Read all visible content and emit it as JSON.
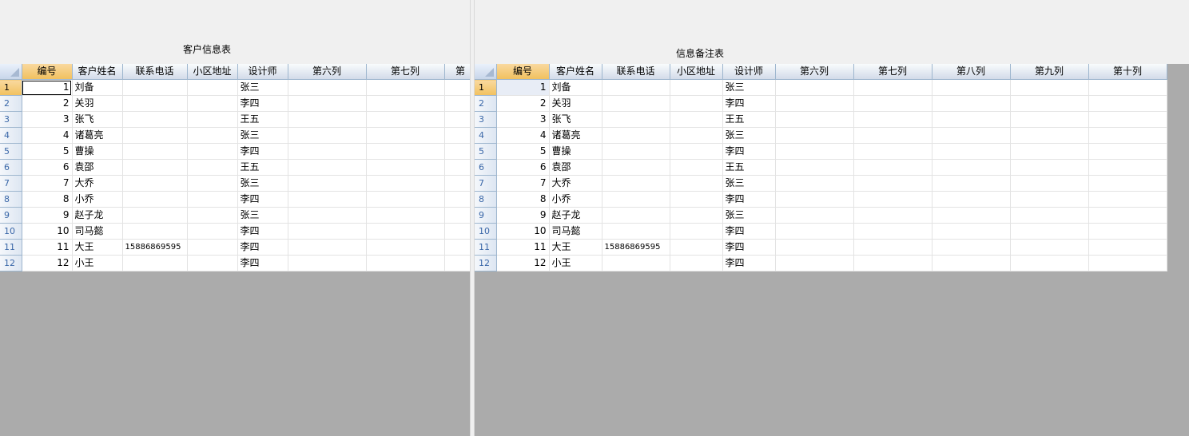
{
  "left_sheet": {
    "title": "客户信息表",
    "headers": [
      "编号",
      "客户姓名",
      "联系电话",
      "小区地址",
      "设计师",
      "第六列",
      "第七列",
      "第"
    ],
    "rows": [
      {
        "rownum": "1",
        "id": "1",
        "name": "刘备",
        "phone": "",
        "address": "",
        "designer": "张三"
      },
      {
        "rownum": "2",
        "id": "2",
        "name": "关羽",
        "phone": "",
        "address": "",
        "designer": "李四"
      },
      {
        "rownum": "3",
        "id": "3",
        "name": "张飞",
        "phone": "",
        "address": "",
        "designer": "王五"
      },
      {
        "rownum": "4",
        "id": "4",
        "name": "诸葛亮",
        "phone": "",
        "address": "",
        "designer": "张三"
      },
      {
        "rownum": "5",
        "id": "5",
        "name": "曹操",
        "phone": "",
        "address": "",
        "designer": "李四"
      },
      {
        "rownum": "6",
        "id": "6",
        "name": "袁邵",
        "phone": "",
        "address": "",
        "designer": "王五"
      },
      {
        "rownum": "7",
        "id": "7",
        "name": "大乔",
        "phone": "",
        "address": "",
        "designer": "张三"
      },
      {
        "rownum": "8",
        "id": "8",
        "name": "小乔",
        "phone": "",
        "address": "",
        "designer": "李四"
      },
      {
        "rownum": "9",
        "id": "9",
        "name": "赵子龙",
        "phone": "",
        "address": "",
        "designer": "张三"
      },
      {
        "rownum": "10",
        "id": "10",
        "name": "司马懿",
        "phone": "",
        "address": "",
        "designer": "李四"
      },
      {
        "rownum": "11",
        "id": "11",
        "name": "大王",
        "phone": "15886869595",
        "address": "",
        "designer": "李四"
      },
      {
        "rownum": "12",
        "id": "12",
        "name": "小王",
        "phone": "",
        "address": "",
        "designer": "李四"
      }
    ]
  },
  "right_sheet": {
    "title": "信息备注表",
    "headers": [
      "编号",
      "客户姓名",
      "联系电话",
      "小区地址",
      "设计师",
      "第六列",
      "第七列",
      "第八列",
      "第九列",
      "第十列"
    ],
    "rows": [
      {
        "rownum": "1",
        "id": "1",
        "name": "刘备",
        "phone": "",
        "address": "",
        "designer": "张三"
      },
      {
        "rownum": "2",
        "id": "2",
        "name": "关羽",
        "phone": "",
        "address": "",
        "designer": "李四"
      },
      {
        "rownum": "3",
        "id": "3",
        "name": "张飞",
        "phone": "",
        "address": "",
        "designer": "王五"
      },
      {
        "rownum": "4",
        "id": "4",
        "name": "诸葛亮",
        "phone": "",
        "address": "",
        "designer": "张三"
      },
      {
        "rownum": "5",
        "id": "5",
        "name": "曹操",
        "phone": "",
        "address": "",
        "designer": "李四"
      },
      {
        "rownum": "6",
        "id": "6",
        "name": "袁邵",
        "phone": "",
        "address": "",
        "designer": "王五"
      },
      {
        "rownum": "7",
        "id": "7",
        "name": "大乔",
        "phone": "",
        "address": "",
        "designer": "张三"
      },
      {
        "rownum": "8",
        "id": "8",
        "name": "小乔",
        "phone": "",
        "address": "",
        "designer": "李四"
      },
      {
        "rownum": "9",
        "id": "9",
        "name": "赵子龙",
        "phone": "",
        "address": "",
        "designer": "张三"
      },
      {
        "rownum": "10",
        "id": "10",
        "name": "司马懿",
        "phone": "",
        "address": "",
        "designer": "李四"
      },
      {
        "rownum": "11",
        "id": "11",
        "name": "大王",
        "phone": "15886869595",
        "address": "",
        "designer": "李四"
      },
      {
        "rownum": "12",
        "id": "12",
        "name": "小王",
        "phone": "",
        "address": "",
        "designer": "李四"
      }
    ]
  },
  "colors": {
    "header_active": "#f1c15f",
    "header_bg": "#d3dbe9",
    "grid_background": "#ababab",
    "row_header_text": "#3a67a8"
  }
}
